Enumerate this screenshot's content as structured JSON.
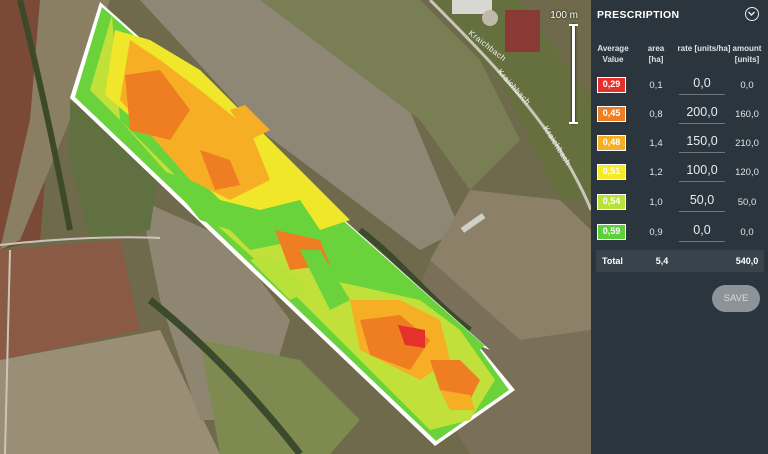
{
  "map": {
    "scale_label": "100 m",
    "road_labels": [
      "Kraichbach",
      "Kraichbach",
      "Kraichbach"
    ]
  },
  "panel": {
    "title": "PRESCRIPTION",
    "collapse_icon": "chevron-down-circle-icon",
    "headers": {
      "avg": "Average Value",
      "area": "area [ha]",
      "rate": "rate [units/ha]",
      "amount": "amount [units]"
    },
    "rows": [
      {
        "value": "0,29",
        "color": "#e4312b",
        "area": "0,1",
        "rate": "0,0",
        "amount": "0,0"
      },
      {
        "value": "0,45",
        "color": "#ef7d22",
        "area": "0,8",
        "rate": "200,0",
        "amount": "160,0"
      },
      {
        "value": "0,48",
        "color": "#f6ae25",
        "area": "1,4",
        "rate": "150,0",
        "amount": "210,0"
      },
      {
        "value": "0,51",
        "color": "#f4ea27",
        "area": "1,2",
        "rate": "100,0",
        "amount": "120,0"
      },
      {
        "value": "0,54",
        "color": "#b8e23a",
        "area": "1,0",
        "rate": "50,0",
        "amount": "50,0"
      },
      {
        "value": "0,59",
        "color": "#5bd13a",
        "area": "0,9",
        "rate": "0,0",
        "amount": "0,0"
      }
    ],
    "total": {
      "label": "Total",
      "area": "5,4",
      "amount": "540,0"
    },
    "save_label": "SAVE"
  }
}
